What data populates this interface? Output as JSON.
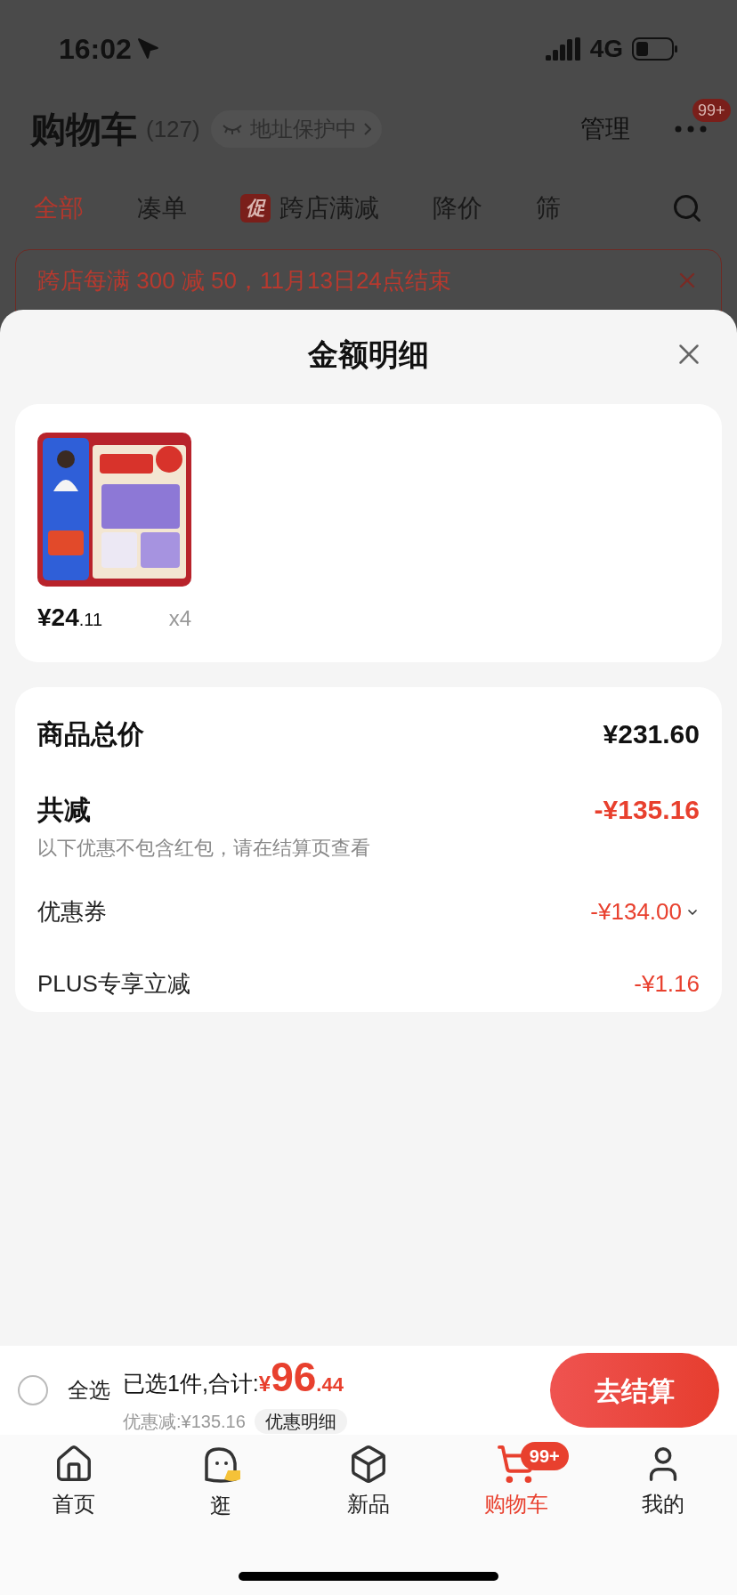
{
  "status_bar": {
    "time": "16:02",
    "network": "4G"
  },
  "header": {
    "title": "购物车",
    "count": "(127)",
    "address_badge": "地址保护中",
    "manage": "管理",
    "more_badge": "99+"
  },
  "filter_tabs": [
    {
      "label": "全部",
      "selected": true
    },
    {
      "label": "凑单",
      "selected": false
    },
    {
      "label": "跨店满减",
      "selected": false,
      "tag": "促"
    },
    {
      "label": "降价",
      "selected": false
    },
    {
      "label": "筛",
      "selected": false
    }
  ],
  "promo_banner": {
    "text": "跨店每满 300 减 50，11月13日24点结束"
  },
  "sheet": {
    "title": "金额明细",
    "items": [
      {
        "kind": "picture",
        "price_main": "¥24",
        "price_decimal": ".11",
        "quantity": "x4"
      }
    ],
    "summary": [
      {
        "kind": "total",
        "label": "商品总价",
        "value": "¥231.60"
      },
      {
        "kind": "discount_total",
        "label": "共减",
        "value": "-¥135.16",
        "note": "以下优惠不包含红包，请在结算页查看"
      },
      {
        "kind": "detail",
        "label": "优惠券",
        "value": "-¥134.00",
        "expandable": true
      },
      {
        "kind": "detail",
        "label": "PLUS专享立减",
        "value": "-¥1.16",
        "expandable": false
      }
    ]
  },
  "checkout": {
    "select_all": {
      "label": "全选",
      "checked": false
    },
    "selected_text": "已选1件,合计:",
    "currency": "¥",
    "total_main": "96",
    "total_decimal": ".44",
    "discount_text": "优惠减:¥135.16",
    "details_button": "优惠明细",
    "checkout_button": "去结算"
  },
  "nav": [
    {
      "kind": "home",
      "label": "首页",
      "selected": false
    },
    {
      "kind": "browse",
      "label": "逛",
      "selected": false
    },
    {
      "kind": "new",
      "label": "新品",
      "selected": false
    },
    {
      "kind": "cart",
      "label": "购物车",
      "selected": true,
      "badge": "99+"
    },
    {
      "kind": "me",
      "label": "我的",
      "selected": false
    }
  ]
}
